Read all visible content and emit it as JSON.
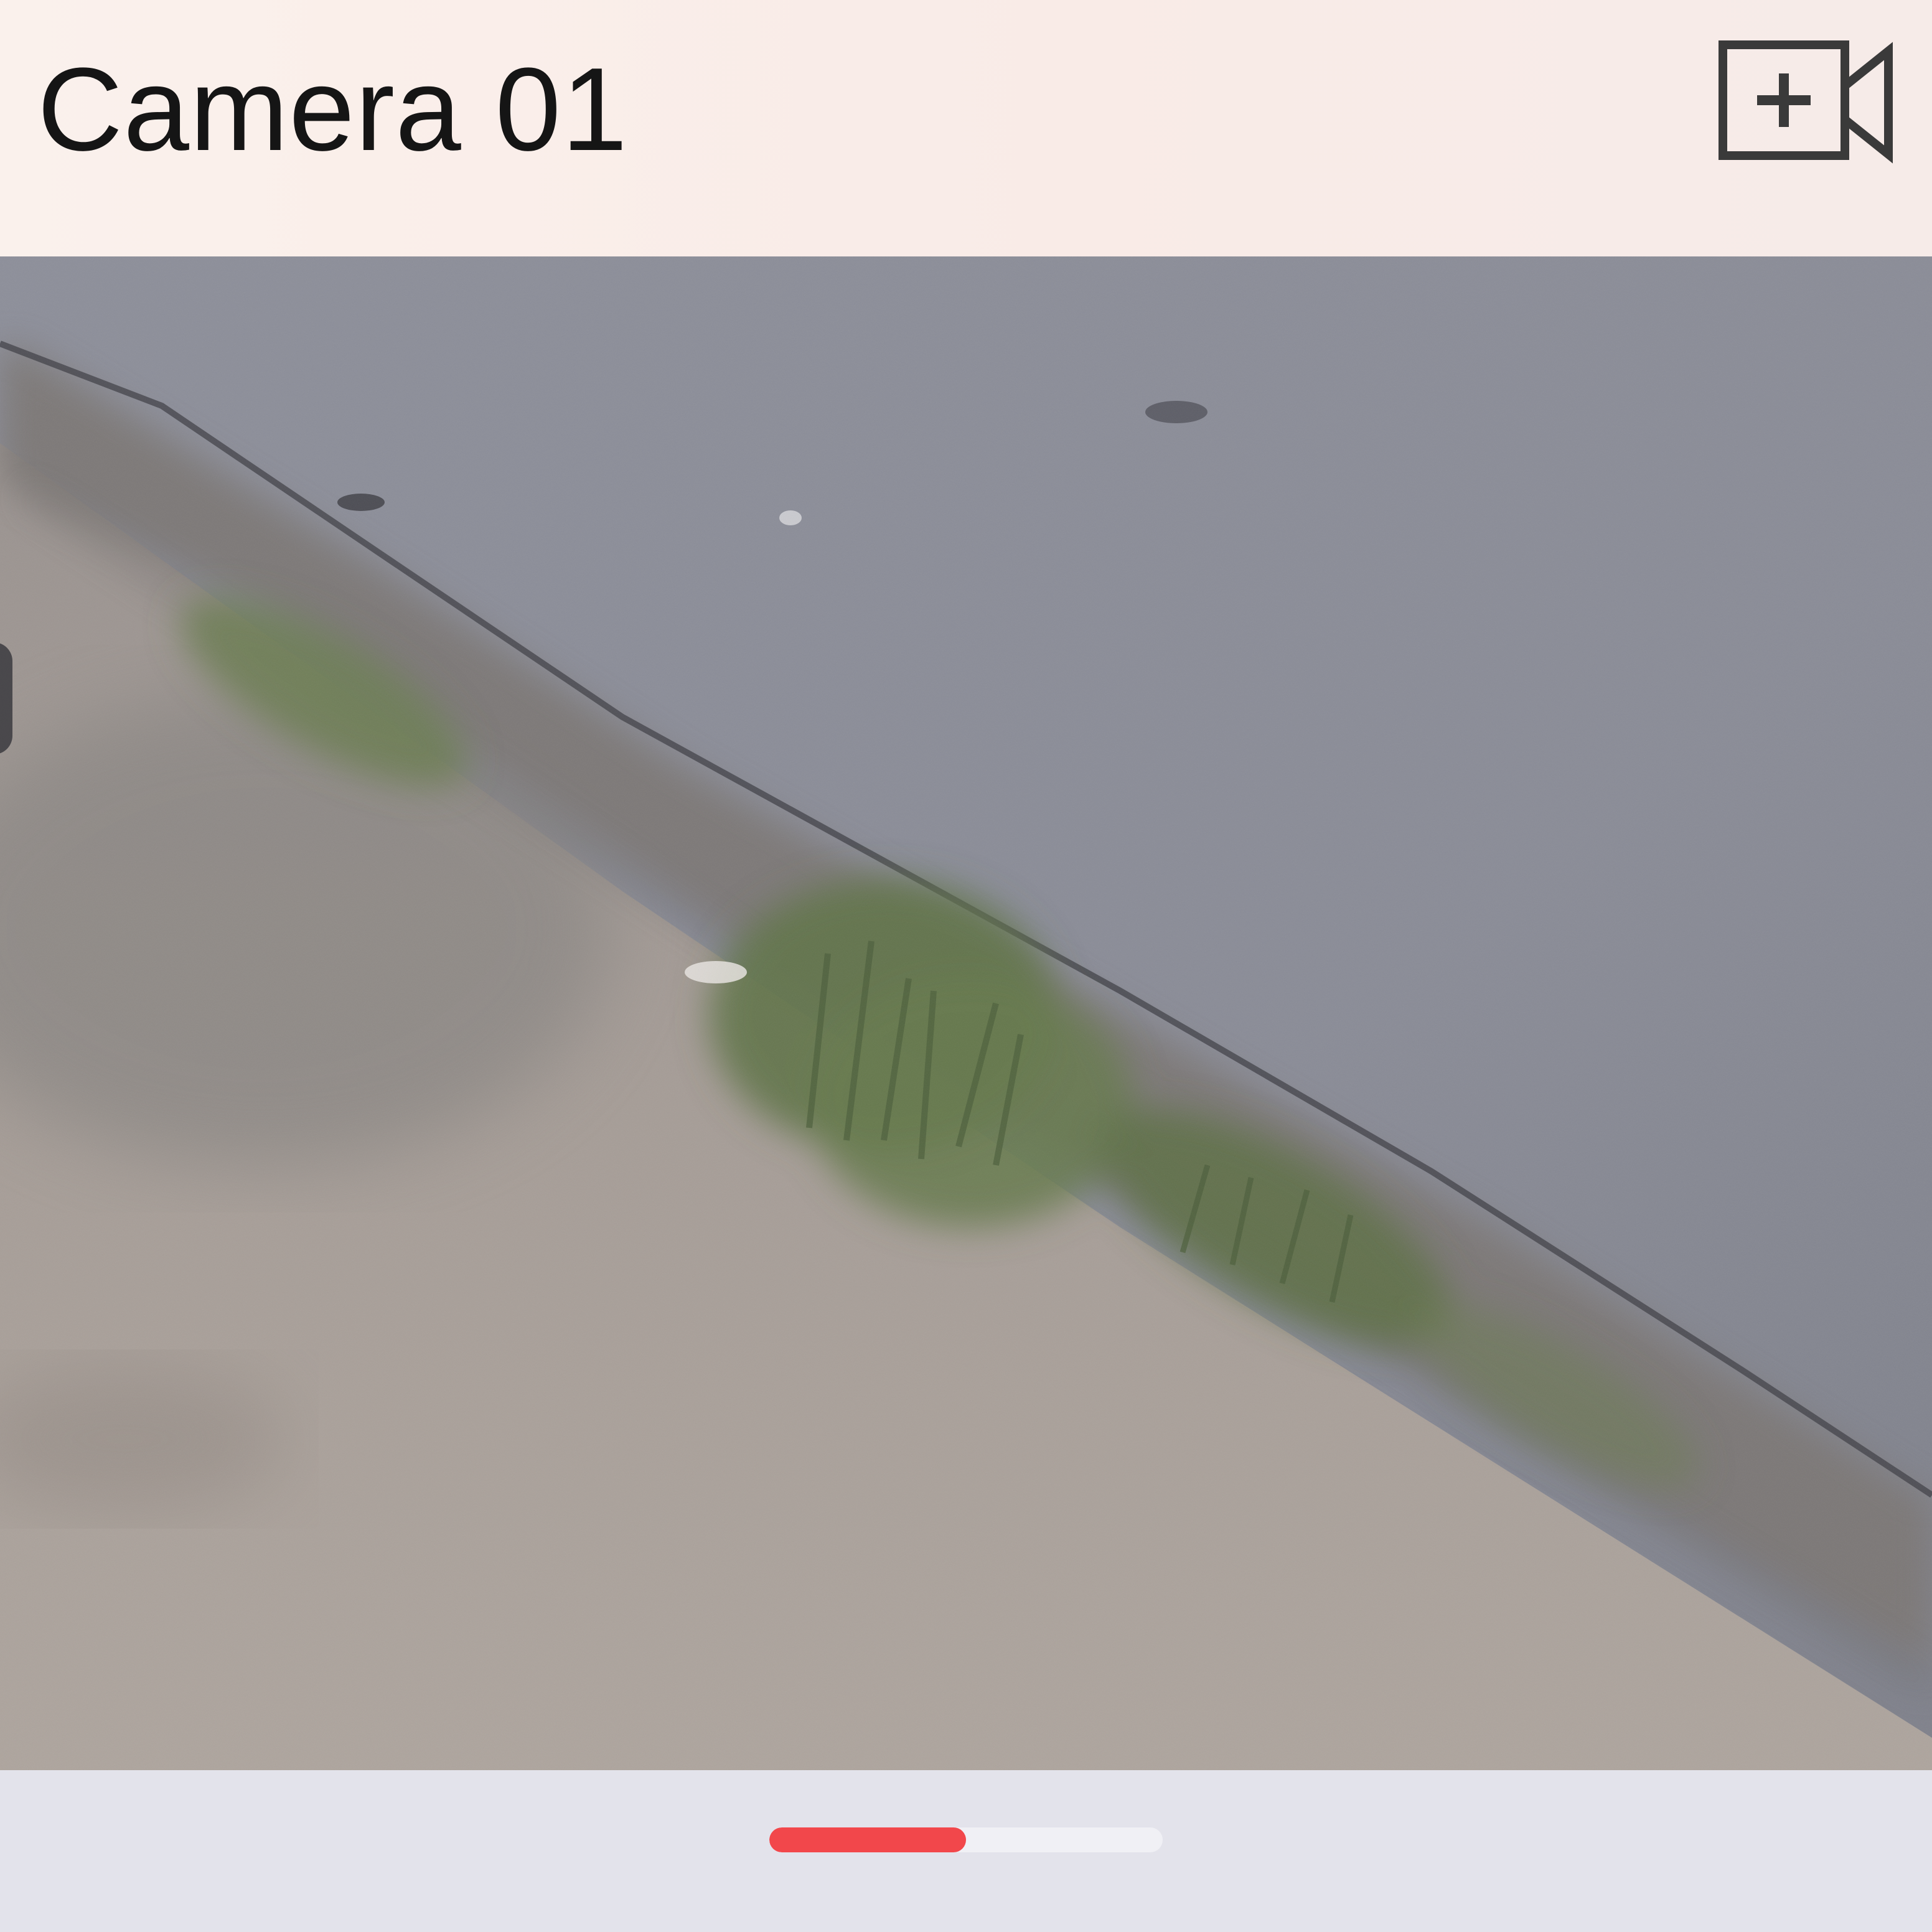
{
  "header": {
    "title": "Camera 01",
    "action_icon": "add-camera-icon"
  },
  "video": {
    "content": "live-camera-feed"
  },
  "pager": {
    "progress": 0.5
  },
  "colors": {
    "header_bg": "#f9ede8",
    "title_text": "#151515",
    "icon": "#3a3a3a",
    "accent": "#f2474b",
    "track": "#f0f0f5",
    "footer_bg": "#e3e3eb"
  }
}
